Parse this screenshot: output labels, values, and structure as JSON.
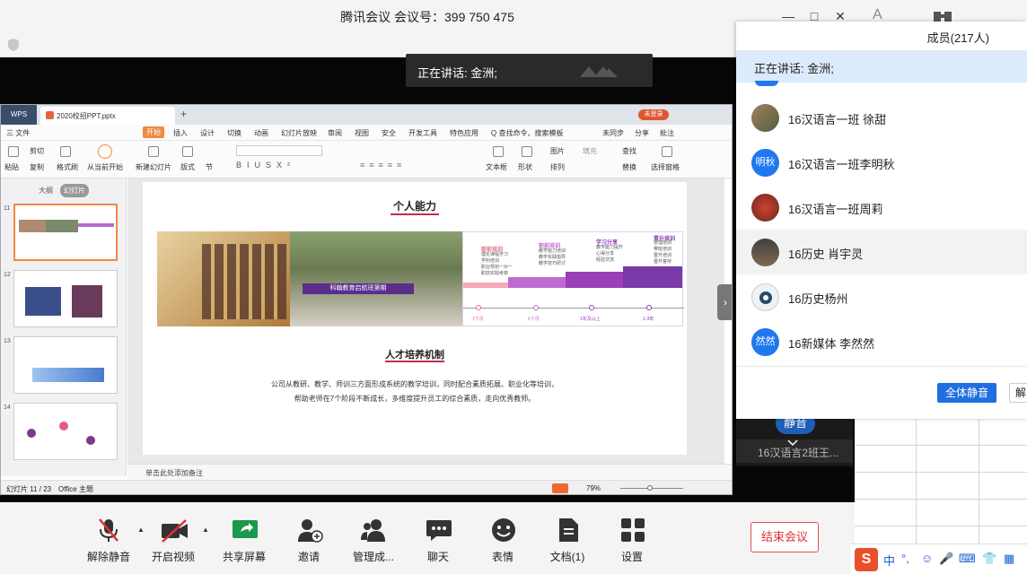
{
  "window": {
    "title": "腾讯会议 会议号：399 750 475"
  },
  "speaking_toast": "正在讲话: 金洲;",
  "ppt": {
    "app_tab": "WPS",
    "file_tab": "2020校招PPT.pptx",
    "unlogged_badge": "未登录",
    "menu": [
      "三 文件",
      "开始",
      "插入",
      "设计",
      "切换",
      "动画",
      "幻灯片放映",
      "审阅",
      "视图",
      "安全",
      "开发工具",
      "特色应用",
      "Q 查找命令、搜索模板",
      "未同步",
      "分享",
      "批注"
    ],
    "ribbon": [
      "粘贴",
      "剪切",
      "复制",
      "格式刷",
      "从当前开始",
      "新建幻灯片",
      "版式",
      "节",
      "文本框",
      "形状",
      "图片",
      "排列",
      "填充",
      "查找",
      "替换",
      "选择窗格"
    ],
    "view_tabs": [
      "大纲",
      "幻灯片"
    ],
    "slide_numbers": [
      "11",
      "12",
      "13",
      "14"
    ],
    "slide": {
      "heading1": "个人能力",
      "timeline_stages": [
        {
          "label": "职前培训",
          "time": "1个月",
          "items": [
            "理论课程学习",
            "学科培训",
            "职业规划一对一",
            "职前实践考核"
          ]
        },
        {
          "label": "职前培训",
          "time": "6个月",
          "items": [
            "教学能力培训",
            "教学实践指导",
            "教学技巧研讨"
          ]
        },
        {
          "label": "学习分享",
          "time": "1年及以上",
          "items": [
            "教学能力提升",
            "心得分享",
            "经验交流"
          ]
        },
        {
          "label": "晋升培训",
          "time": "1-3年",
          "items": [
            "管理培训",
            "带班培训",
            "晋升培训",
            "晋升答辩"
          ]
        }
      ],
      "banner_text": "科翰教育启航班第期",
      "heading2": "人才培养机制",
      "body_line1": "公司从教研、教学、师训三方面形成系统的教学培训，同时配合素质拓展、职业化等培训，",
      "body_line2": "帮助老师在7个阶段不断成长，多维度提升员工的综合素质，走向优秀教师。"
    },
    "notes_placeholder": "单击此处添加备注",
    "status": {
      "slide_counter": "幻灯片 11 / 23",
      "theme": "Office 主题",
      "zoom": "79%"
    }
  },
  "members_panel": {
    "title": "成员(217人)",
    "speaking": "正在讲话: 金洲;",
    "members": [
      {
        "name": "16汉语言一班 徐甜",
        "avatar_text": "",
        "avatar_kind": "photo"
      },
      {
        "name": "16汉语言一班李明秋",
        "avatar_text": "明秋",
        "avatar_kind": "blue"
      },
      {
        "name": "16汉语言一班周莉",
        "avatar_text": "",
        "avatar_kind": "photo"
      },
      {
        "name": "16历史 肖宇灵",
        "avatar_text": "",
        "avatar_kind": "photo"
      },
      {
        "name": "16历史杨州",
        "avatar_text": "",
        "avatar_kind": "photo"
      },
      {
        "name": "16新媒体 李然然",
        "avatar_text": "然然",
        "avatar_kind": "blue"
      }
    ],
    "mute_all": "全体静音",
    "next_button_partial": "解"
  },
  "video_tile": {
    "name": "16汉语言2班王...",
    "mute_label": "静音"
  },
  "toolbar": {
    "unmute": "解除静音",
    "start_video": "开启视频",
    "share_screen": "共享屏幕",
    "invite": "邀请",
    "manage_members": "管理成...",
    "chat": "聊天",
    "reactions": "表情",
    "docs": "文档(1)",
    "settings": "设置",
    "end_meeting": "结束会议"
  },
  "colors": {
    "accent_blue": "#1f6fe0",
    "end_red": "#e03030",
    "timeline_purple": "#8a3fb0",
    "timeline_pink": "#e86a86",
    "ribbon_orange": "#f08a40"
  }
}
